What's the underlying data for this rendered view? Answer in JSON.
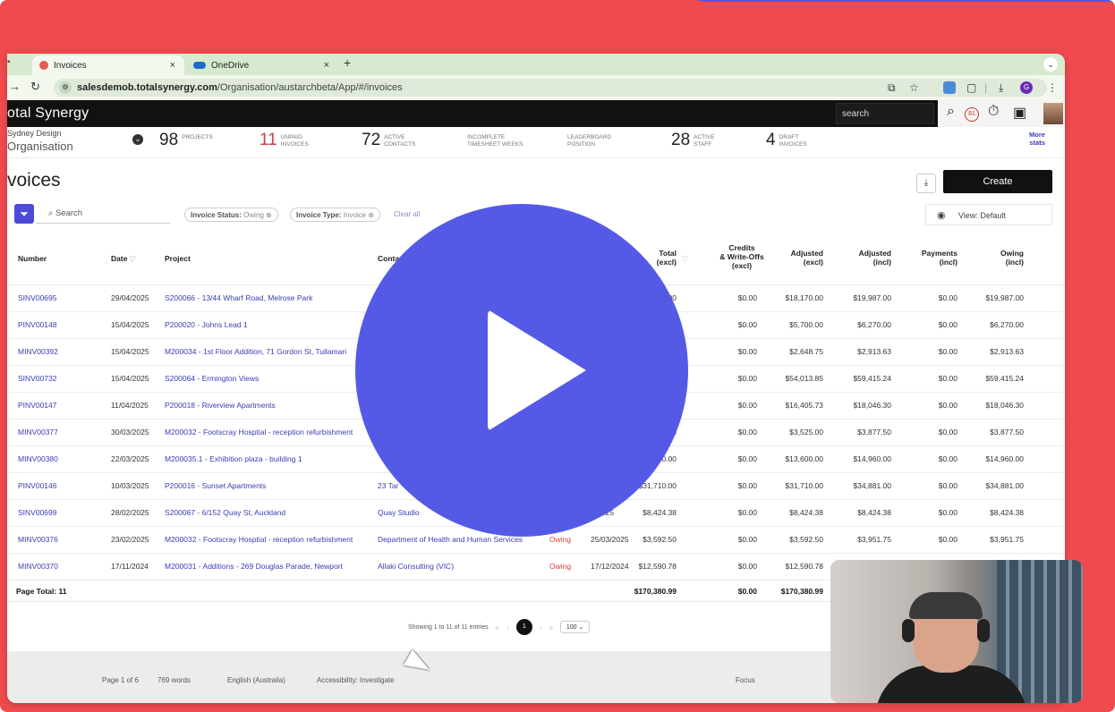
{
  "browser": {
    "tabs": [
      {
        "label": "Invoices",
        "close": "×"
      },
      {
        "label": "OneDrive",
        "close": "×"
      }
    ],
    "new_tab": "+",
    "url_host": "salesdemob.totalsynergy.com",
    "url_path": "/Organisation/austarchbeta/App/#/invoices",
    "profile_initial": "G"
  },
  "app": {
    "brand": "otal Synergy",
    "search_placeholder": "search",
    "notif_count": "81"
  },
  "stats": {
    "org_name": "Sydney Design",
    "org_sub": "Organisation",
    "items": [
      {
        "num": "98",
        "label1": "PROJECTS",
        "label2": ""
      },
      {
        "num": "11",
        "label1": "UNPAID",
        "label2": "INVOICES"
      },
      {
        "num": "72",
        "label1": "ACTIVE",
        "label2": "CONTACTS"
      },
      {
        "num": "",
        "label1": "INCOMPLETE",
        "label2": "TIMESHEET WEEKS"
      },
      {
        "num": "",
        "label1": "LEADERBOARD",
        "label2": "POSITION"
      },
      {
        "num": "28",
        "label1": "ACTIVE",
        "label2": "STAFF"
      },
      {
        "num": "4",
        "label1": "DRAFT",
        "label2": "INVOICES"
      }
    ],
    "more1": "More",
    "more2": "stats"
  },
  "page": {
    "title": "voices",
    "create_label": "Create",
    "search_placeholder": "Search",
    "chip1_key": "Invoice Status:",
    "chip1_val": "Owing",
    "chip2_key": "Invoice Type:",
    "chip2_val": "Invoice",
    "clear_all": "Clear all",
    "view_label": "View: Default"
  },
  "table": {
    "headers": {
      "number": "Number",
      "date": "Date",
      "project": "Project",
      "contact": "Conta",
      "total1": "Total",
      "total2": "(excl)",
      "credits1": "Credits",
      "credits2": "& Write-Offs",
      "credits3": "(excl)",
      "adj_ex1": "Adjusted",
      "adj_ex2": "(excl)",
      "adj_in1": "Adjusted",
      "adj_in2": "(incl)",
      "pay1": "Payments",
      "pay2": "(incl)",
      "owing1": "Owing",
      "owing2": "(incl)"
    },
    "rows": [
      {
        "num": "SINV00695",
        "date": "29/04/2025",
        "project": "S200066 - 13/44 Wharf Road, Melrose Park",
        "contact": "",
        "status": "",
        "due": "",
        "total": "70.00",
        "credits": "$0.00",
        "adj_ex": "$18,170.00",
        "adj_in": "$19,987.00",
        "pay": "$0.00",
        "owing": "$19,987.00"
      },
      {
        "num": "PINV00148",
        "date": "15/04/2025",
        "project": "P200020 - Johns Lead 1",
        "contact": "",
        "status": "",
        "due": "",
        "total": "00",
        "credits": "$0.00",
        "adj_ex": "$5,700.00",
        "adj_in": "$6,270.00",
        "pay": "$0.00",
        "owing": "$6,270.00"
      },
      {
        "num": "MINV00392",
        "date": "15/04/2025",
        "project": "M200034 - 1st Floor Addition, 71 Gordon St, Tullamari",
        "contact": "",
        "status": "",
        "due": "",
        "total": "",
        "credits": "$0.00",
        "adj_ex": "$2,648.75",
        "adj_in": "$2,913.63",
        "pay": "$0.00",
        "owing": "$2,913.63"
      },
      {
        "num": "SINV00732",
        "date": "15/04/2025",
        "project": "S200064 - Ermington Views",
        "contact": "",
        "status": "",
        "due": "",
        "total": "",
        "credits": "$0.00",
        "adj_ex": "$54,013.85",
        "adj_in": "$59,415.24",
        "pay": "$0.00",
        "owing": "$59,415.24"
      },
      {
        "num": "PINV00147",
        "date": "11/04/2025",
        "project": "P200018 - Riverview Apartments",
        "contact": "",
        "status": "",
        "due": "",
        "total": "3",
        "credits": "$0.00",
        "adj_ex": "$16,405.73",
        "adj_in": "$18,046.30",
        "pay": "$0.00",
        "owing": "$18,046.30"
      },
      {
        "num": "MINV00377",
        "date": "30/03/2025",
        "project": "M200032 - Footscray Hosptial - reception refurbishment",
        "contact": "",
        "status": "",
        "due": "",
        "total": ".00",
        "credits": "$0.00",
        "adj_ex": "$3,525.00",
        "adj_in": "$3,877.50",
        "pay": "$0.00",
        "owing": "$3,877.50"
      },
      {
        "num": "MINV00380",
        "date": "22/03/2025",
        "project": "M200035.1 - Exhibition plaza - building 1",
        "contact": "",
        "status": "",
        "due": "",
        "total": "600.00",
        "credits": "$0.00",
        "adj_ex": "$13,600.00",
        "adj_in": "$14,960.00",
        "pay": "$0.00",
        "owing": "$14,960.00"
      },
      {
        "num": "PINV00146",
        "date": "10/03/2025",
        "project": "P200016 - Sunset Apartments",
        "contact": "23 Tar",
        "status": "",
        "due": "",
        "total": "$31,710.00",
        "credits": "$0.00",
        "adj_ex": "$31,710.00",
        "adj_in": "$34,881.00",
        "pay": "$0.00",
        "owing": "$34,881.00"
      },
      {
        "num": "SINV00699",
        "date": "28/02/2025",
        "project": "S200067 - 6/152 Quay St, Auckland",
        "contact": "Quay Studio",
        "status": "",
        "due": "3/2025",
        "total": "$8,424.38",
        "credits": "$0.00",
        "adj_ex": "$8,424.38",
        "adj_in": "$8,424.38",
        "pay": "$0.00",
        "owing": "$8,424.38"
      },
      {
        "num": "MINV00376",
        "date": "23/02/2025",
        "project": "M200032 - Footscray Hosptial - reception refurbishment",
        "contact": "Department of Health and Human Services",
        "status": "Owing",
        "due": "25/03/2025",
        "total": "$3,592.50",
        "credits": "$0.00",
        "adj_ex": "$3,592.50",
        "adj_in": "$3,951.75",
        "pay": "$0.00",
        "owing": "$3,951.75"
      },
      {
        "num": "MINV00370",
        "date": "17/11/2024",
        "project": "M200031 - Additions - 269 Douglas Parade, Newport",
        "contact": "Allaki Consulting (VIC)",
        "status": "Owing",
        "due": "17/12/2024",
        "total": "$12,590.78",
        "credits": "$0.00",
        "adj_ex": "$12,590.78",
        "adj_in": "",
        "pay": "",
        "owing": ""
      }
    ],
    "page_total_label": "Page Total: 11",
    "page_total_total": "$170,380.99",
    "page_total_credits": "$0.00",
    "page_total_adj": "$170,380.99"
  },
  "pager": {
    "showing": "Showing 1 to 11 of 11 entries",
    "page": "1",
    "per_page": "100"
  },
  "statusbar": {
    "page": "Page 1 of 6",
    "words": "769 words",
    "lang": "English (Australia)",
    "access": "Accessibility: Investigate",
    "focus": "Focus"
  }
}
